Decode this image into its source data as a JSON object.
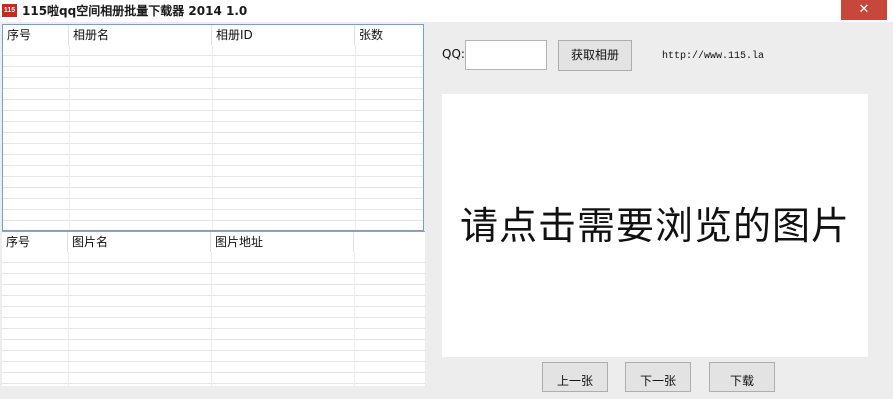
{
  "window": {
    "title": "115啦qq空间相册批量下载器 2014 1.0",
    "icon_text": "115",
    "close_glyph": "✕"
  },
  "album_list": {
    "columns": [
      "序号",
      "相册名",
      "相册ID",
      "张数"
    ]
  },
  "photo_list": {
    "columns": [
      "序号",
      "图片名",
      "图片地址"
    ]
  },
  "qq": {
    "label": "QQ:",
    "value": ""
  },
  "fetch_button": "获取相册",
  "website": "http://www.115.la",
  "preview": {
    "text": "请点击需要浏览的图片"
  },
  "nav": {
    "prev": "上一张",
    "next": "下一张",
    "download": "下载"
  }
}
